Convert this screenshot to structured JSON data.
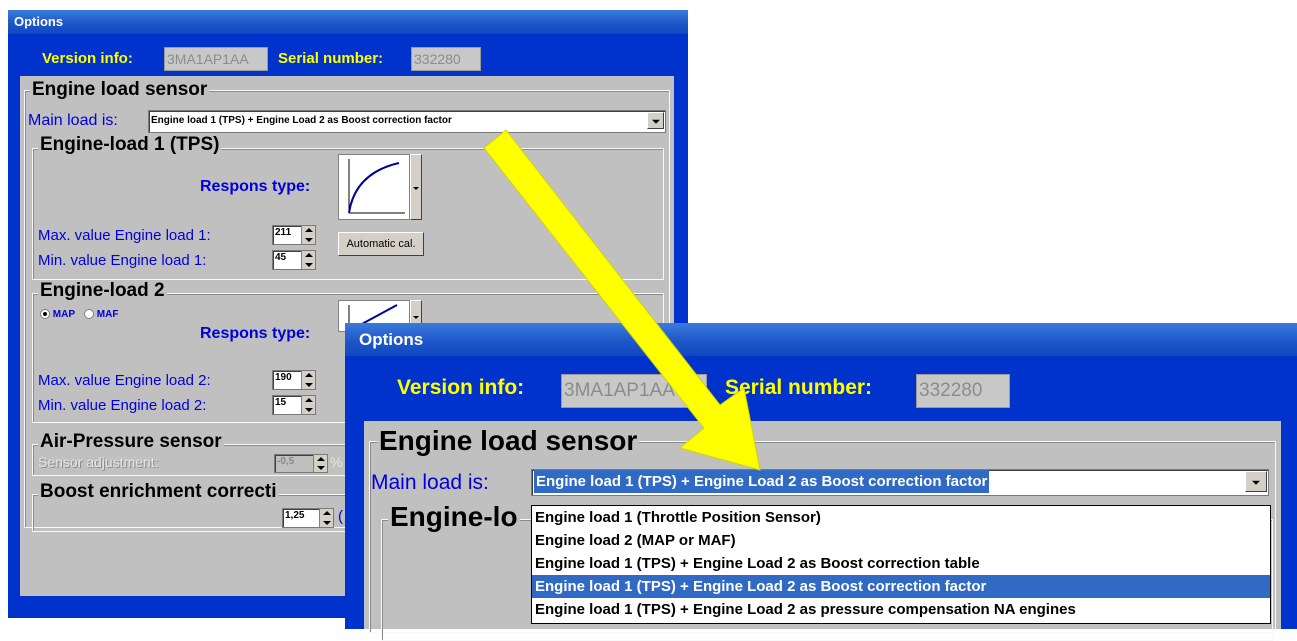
{
  "window": {
    "title": "Options",
    "version_label": "Version info:",
    "version_value": "3MA1AP1AA",
    "serial_label": "Serial number:",
    "serial_value": "332280"
  },
  "engine_load_sensor": {
    "title": "Engine load sensor",
    "main_load_label": "Main load is:",
    "main_load_value": "Engine load 1 (TPS) + Engine Load 2 as Boost correction factor"
  },
  "load1": {
    "title": "Engine-load 1 (TPS)",
    "respons_label": "Respons type:",
    "max_label": "Max. value Engine load 1:",
    "max_value": "211",
    "min_label": "Min.  value Engine load 1:",
    "min_value": "45",
    "auto_cal_label": "Automatic cal."
  },
  "load2": {
    "title": "Engine-load 2",
    "radio_map": "MAP",
    "radio_maf": "MAF",
    "respons_label": "Respons type:",
    "max_label": "Max. value Engine load 2:",
    "max_value": "190",
    "min_label": "Min.  value Engine load 2:",
    "min_value": "15"
  },
  "air_pressure": {
    "title": "Air-Pressure sensor",
    "adjust_label": "Sensor adjustment:",
    "adjust_value": "-0,5",
    "unit": "%"
  },
  "boost": {
    "title": "Boost enrichment correcti",
    "value": "1,25",
    "suffix": "("
  },
  "zoom": {
    "title": "Options",
    "version_label": "Version info:",
    "version_value": "3MA1AP1AA",
    "serial_label": "Serial number:",
    "serial_value": "332280",
    "group_title": "Engine load sensor",
    "main_load_label": "Main load is:",
    "main_load_value": "Engine load 1 (TPS) + Engine Load 2 as Boost correction factor",
    "partial_group_title": "Engine-lo",
    "dropdown_options": [
      "Engine load 1 (Throttle Position Sensor)",
      "Engine load 2 (MAP or MAF)",
      "Engine load 1 (TPS) + Engine Load 2 as Boost correction table",
      "Engine load 1 (TPS) + Engine Load 2 as Boost correction factor",
      "Engine load 1 (TPS) + Engine Load 2 as pressure compensation NA engines"
    ],
    "selected_option": 3
  },
  "colors": {
    "window_blue": "#0033cc",
    "label_yellow": "#ffff00",
    "label_blue": "#0000dd",
    "highlight": "#316ac5",
    "arrow": "#ffff00"
  }
}
